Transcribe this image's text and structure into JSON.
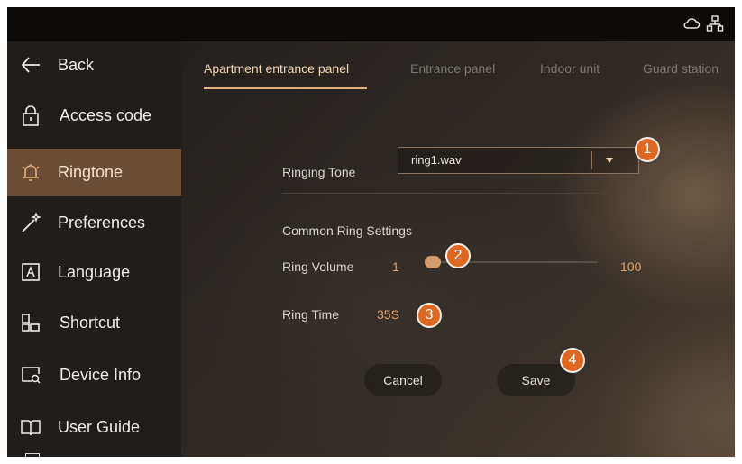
{
  "topbar": {
    "icons": [
      "cloud-icon",
      "network-icon"
    ]
  },
  "sidebar": {
    "items": [
      {
        "label": "Back",
        "icon": "back-arrow-icon"
      },
      {
        "label": "Access code",
        "icon": "lock-icon"
      },
      {
        "label": "Ringtone",
        "icon": "bell-icon",
        "active": true
      },
      {
        "label": "Preferences",
        "icon": "magic-wand-icon"
      },
      {
        "label": "Language",
        "icon": "letter-a-icon"
      },
      {
        "label": "Shortcut",
        "icon": "shortcut-blocks-icon"
      },
      {
        "label": "Device Info",
        "icon": "device-search-icon"
      },
      {
        "label": "User Guide",
        "icon": "book-icon"
      }
    ]
  },
  "tabs": [
    {
      "label": "Apartment entrance panel",
      "active": true
    },
    {
      "label": "Entrance panel"
    },
    {
      "label": "Indoor unit"
    },
    {
      "label": "Guard station"
    }
  ],
  "ringing_tone": {
    "label": "Ringing Tone",
    "value": "ring1.wav"
  },
  "common_ring": {
    "heading": "Common Ring Settings",
    "volume_label": "Ring Volume",
    "volume_min": "1",
    "volume_max": "100",
    "volume_value": 1,
    "time_label": "Ring Time",
    "time_value": "35S"
  },
  "buttons": {
    "cancel": "Cancel",
    "save": "Save"
  },
  "badges": [
    "1",
    "2",
    "3",
    "4"
  ],
  "colors": {
    "accent": "#e3b27f",
    "badge": "#e0671f",
    "active_sidebar": "#6a4d34"
  }
}
